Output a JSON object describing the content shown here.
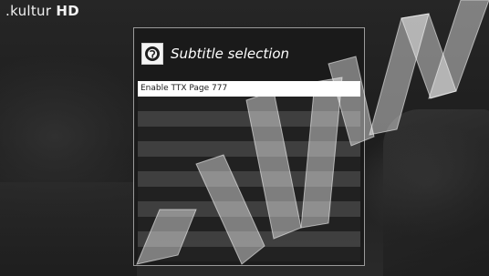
{
  "channel": {
    "logo_name": ".kultur",
    "logo_suffix": "HD"
  },
  "dialog": {
    "title": "Subtitle selection",
    "icon": "subtitle-icon",
    "items": [
      {
        "label": "Enable TTX Page 777",
        "selected": true
      },
      {
        "label": "",
        "selected": false
      },
      {
        "label": "",
        "selected": false
      },
      {
        "label": "",
        "selected": false
      },
      {
        "label": "",
        "selected": false
      },
      {
        "label": "",
        "selected": false
      },
      {
        "label": "",
        "selected": false
      },
      {
        "label": "",
        "selected": false
      },
      {
        "label": "",
        "selected": false
      },
      {
        "label": "",
        "selected": false
      },
      {
        "label": "",
        "selected": false
      },
      {
        "label": "",
        "selected": false
      }
    ]
  }
}
